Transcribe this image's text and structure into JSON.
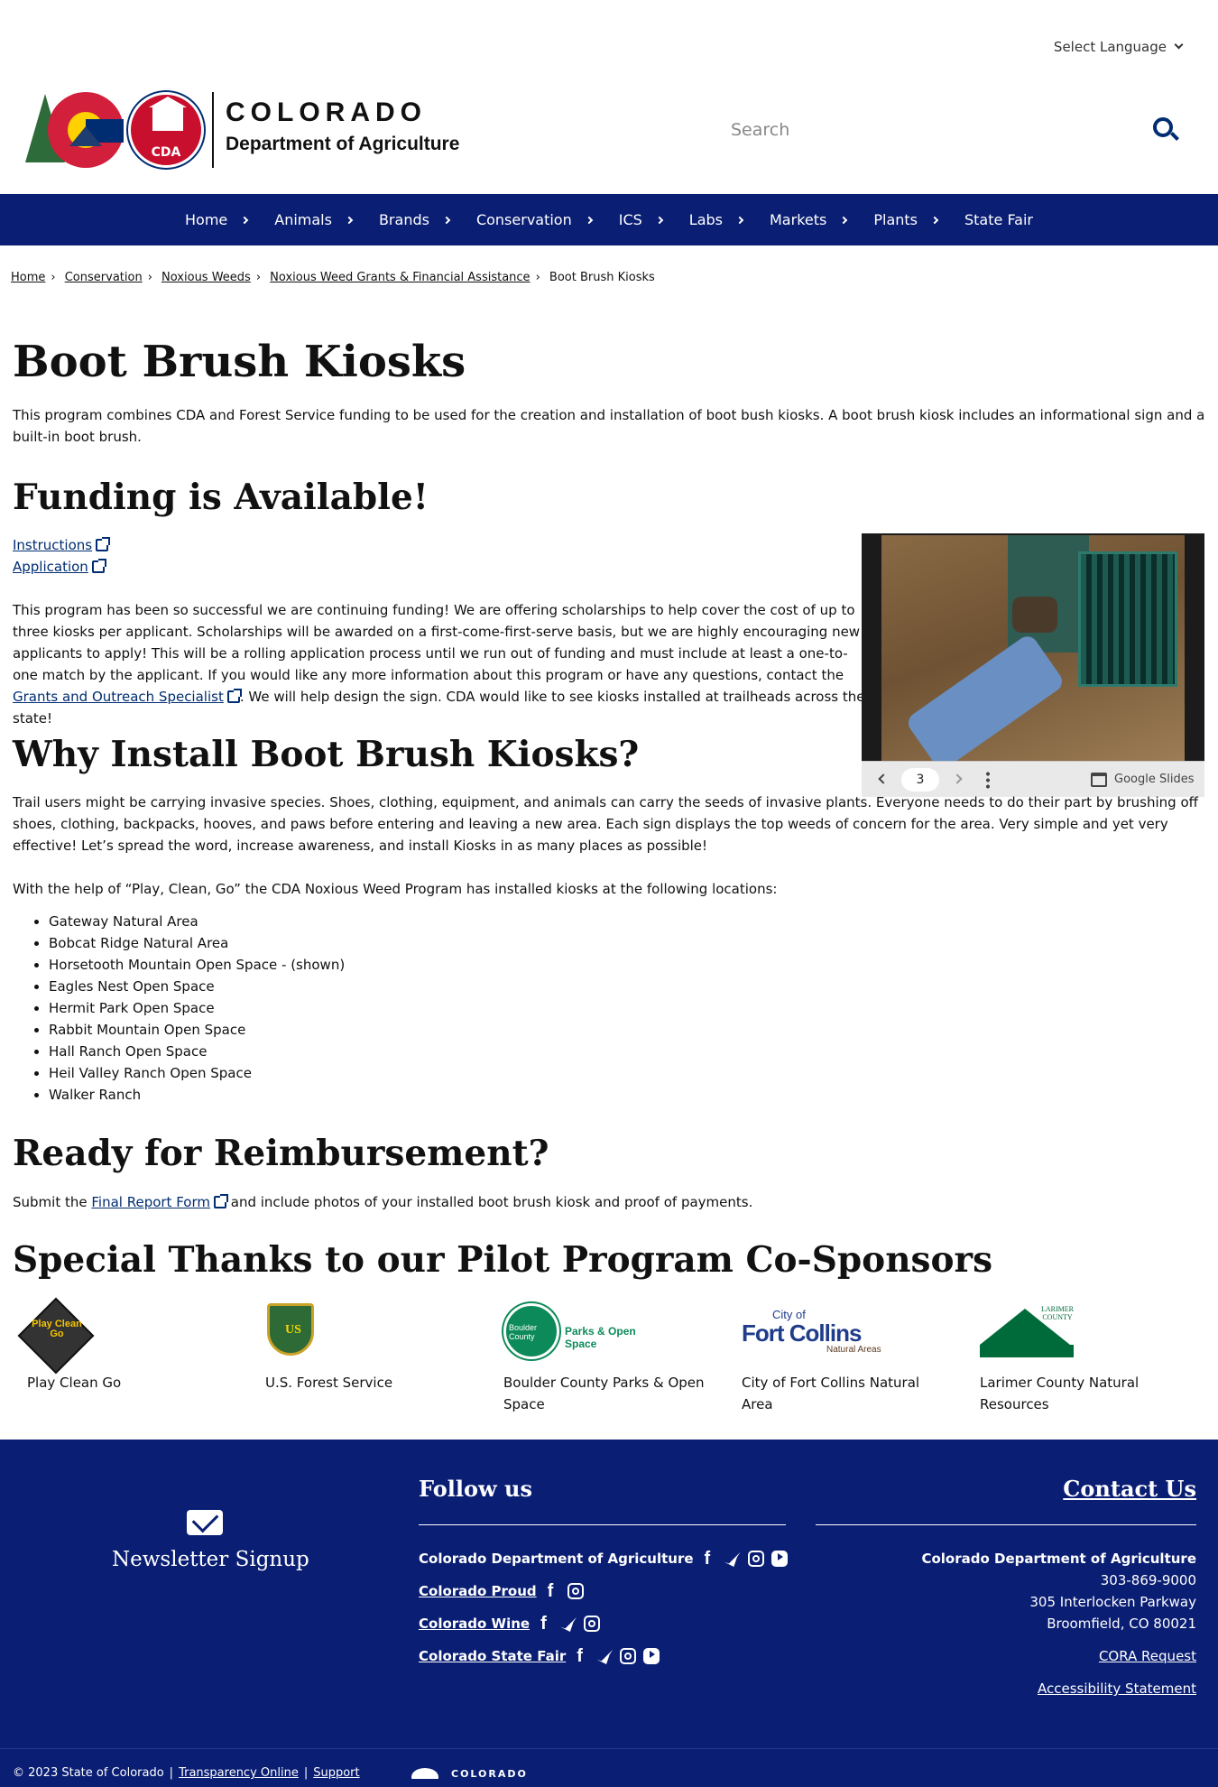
{
  "header": {
    "language_label": "Select Language",
    "logo_title": "COLORADO",
    "logo_subtitle": "Department of Agriculture",
    "logo_badge": "CDA",
    "search_placeholder": "Search"
  },
  "nav": {
    "items": [
      "Home",
      "Animals",
      "Brands",
      "Conservation",
      "ICS",
      "Labs",
      "Markets",
      "Plants",
      "State Fair"
    ]
  },
  "breadcrumb": {
    "items": [
      "Home",
      "Conservation",
      "Noxious Weeds",
      "Noxious Weed Grants & Financial Assistance"
    ],
    "current": "Boot Brush Kiosks"
  },
  "main": {
    "title": "Boot Brush Kiosks",
    "intro": "This program combines CDA and Forest Service funding to be used for the creation and installation of boot bush kiosks. A boot brush kiosk includes an informational sign and a built-in boot brush.",
    "funding_heading": "Funding is Available!",
    "instructions_link": "Instructions",
    "application_link": "Application",
    "funding_text_1": "This program has been so successful we are continuing funding! We are offering scholarships to help cover the cost of up to three kiosks per applicant. Scholarships will be awarded on a first-come-first-serve basis, but we are highly encouraging new applicants to apply! This will be a rolling application process until we run out of funding and must include at least a one-to-one match by the applicant. If you would like any more information about this program or have any questions, contact the ",
    "grants_link": "Grants and Outreach Specialist",
    "funding_text_2": ". We will help design the sign. CDA would like to see kiosks installed at trailheads across the state!",
    "why_heading": "Why Install Boot Brush Kiosks?",
    "why_text": "Trail users might be carrying invasive species. Shoes, clothing, equipment, and animals can carry the seeds of invasive plants. Everyone needs to do their part by brushing off shoes, clothing, backpacks, hooves, and paws before entering and leaving a new area. Each sign displays the top weeds of concern for the area. Very simple and yet very effective! Let’s spread the word, increase awareness, and install Kiosks in as many places as possible!",
    "locations_intro": "With the help of “Play, Clean, Go” the CDA Noxious Weed Program has installed kiosks at the following locations:",
    "locations": [
      "Gateway Natural Area",
      "Bobcat Ridge Natural Area",
      "Horsetooth Mountain Open Space - (shown)",
      "Eagles Nest Open Space",
      "Hermit Park Open Space",
      "Rabbit Mountain Open Space",
      "Hall Ranch Open Space",
      "Heil Valley Ranch Open Space",
      "Walker Ranch"
    ],
    "reimburse_heading": "Ready for Reimbursement?",
    "reimburse_text_1": "Submit the ",
    "final_report_link": "Final Report Form",
    "reimburse_text_2": " and include photos of your installed boot brush kiosk and proof of payments.",
    "thanks_heading": "Special Thanks to our Pilot Program Co-Sponsors"
  },
  "slides": {
    "page": "3",
    "brand": "Google Slides"
  },
  "sponsors": [
    {
      "label": "Play Clean Go",
      "logo_text": "Play Clean Go"
    },
    {
      "label": "U.S. Forest Service",
      "logo_text": "US"
    },
    {
      "label": "Boulder County Parks & Open Space",
      "logo_text": "Boulder County",
      "logo_text2": "Parks & Open Space"
    },
    {
      "label": "City of Fort Collins Natural Area",
      "logo_text": "City of",
      "logo_text2": "Fort Collins",
      "logo_text3": "Natural Areas"
    },
    {
      "label": "Larimer County Natural Resources",
      "logo_text": "LARIMER COUNTY"
    }
  ],
  "footer": {
    "newsletter": "Newsletter Signup",
    "follow_heading": "Follow us",
    "social": [
      {
        "name": "Colorado Department of Agriculture",
        "icons": [
          "facebook-icon",
          "twitter-icon",
          "instagram-icon",
          "youtube-icon"
        ]
      },
      {
        "name": "Colorado Proud",
        "icons": [
          "facebook-icon",
          "instagram-icon"
        ]
      },
      {
        "name": "Colorado Wine",
        "icons": [
          "facebook-icon",
          "twitter-icon",
          "instagram-icon"
        ]
      },
      {
        "name": "Colorado State Fair",
        "icons": [
          "facebook-icon",
          "twitter-icon",
          "instagram-icon",
          "youtube-icon"
        ]
      }
    ],
    "contact_heading": "Contact Us",
    "contact_org": "Colorado Department of Agriculture",
    "contact_phone": "303-869-9000",
    "contact_address1": "305 Interlocken Parkway",
    "contact_address2": "Broomfield, CO 80021",
    "cora_link": "CORA Request",
    "accessibility_link": "Accessibility Statement",
    "copyright": "© 2023 State of Colorado",
    "transparency_link": "Transparency Online",
    "support_link": "Support",
    "state_logo_text": "COLORADO"
  },
  "colors": {
    "nav_bg": "#0a1e73",
    "link": "#002d72"
  }
}
